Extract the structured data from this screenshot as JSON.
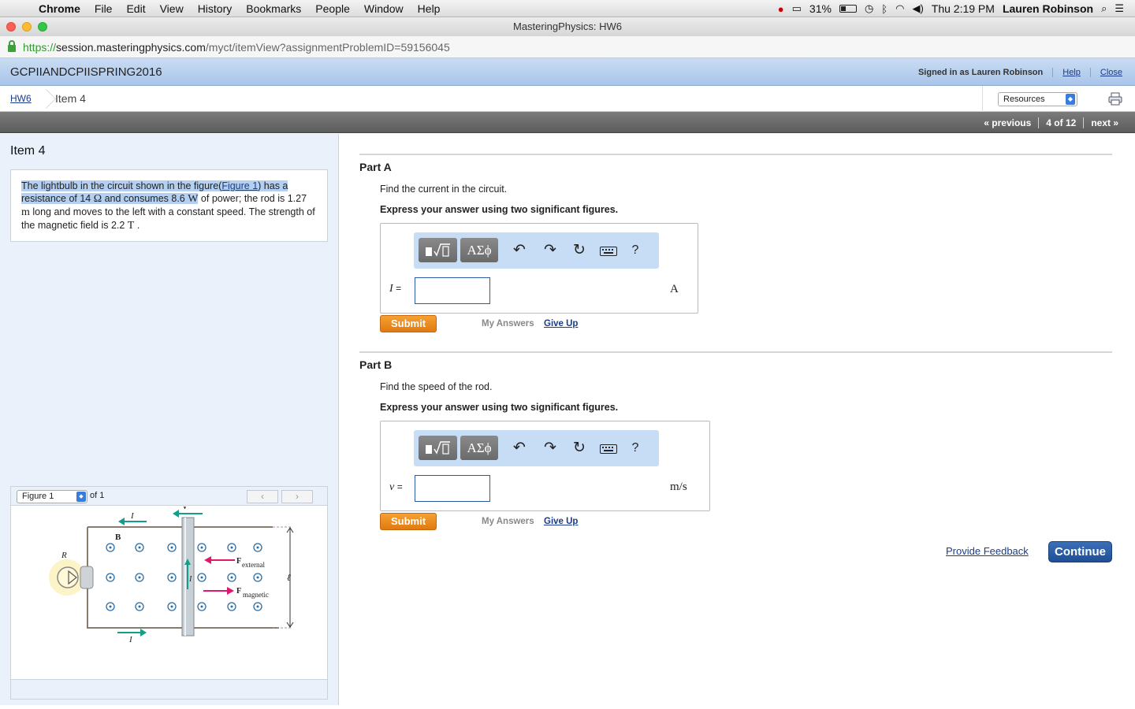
{
  "menubar": {
    "app": "Chrome",
    "items": [
      "File",
      "Edit",
      "View",
      "History",
      "Bookmarks",
      "People",
      "Window",
      "Help"
    ],
    "battery": "31%",
    "clock": "Thu 2:19 PM",
    "user": "Lauren Robinson"
  },
  "window": {
    "title": "MasteringPhysics: HW6"
  },
  "address": {
    "scheme": "https://",
    "host": "session.masteringphysics.com",
    "path": "/myct/itemView?assignmentProblemID=59156045"
  },
  "header": {
    "course": "GCPIIANDCPIISPRING2016",
    "signed_in": "Signed in as Lauren Robinson",
    "help": "Help",
    "close": "Close"
  },
  "breadcrumb": {
    "hw": "HW6",
    "item": "Item 4"
  },
  "resources": {
    "selected": "Resources"
  },
  "pager": {
    "previous": "« previous",
    "position": "4 of 12",
    "next": "next »"
  },
  "left": {
    "title": "Item 4",
    "problem": {
      "p1": "The lightbulb in the circuit shown in the figure(",
      "link": "Figure 1",
      "p2": ") has a resistance of 14 ",
      "u1": "Ω",
      "p3": " and consumes 8.6 ",
      "u2": "W",
      "p4": " of power; the rod is 1.27 ",
      "u3": "m",
      "p5": " long and moves to the left with a constant speed. The strength of the magnetic field is 2.2 ",
      "u4": "T",
      "p6": " ."
    },
    "figure": {
      "select": "Figure 1",
      "of": "of 1",
      "prev": "‹",
      "next": "›",
      "labels": {
        "v": "v",
        "I_top": "I",
        "B": "B",
        "R": "R",
        "I_rod": "I",
        "F": "F",
        "external": "external",
        "magnetic": "magnetic",
        "ell": "ℓ",
        "I_bottom": "I"
      }
    }
  },
  "partA": {
    "title": "Part A",
    "prompt": "Find the current in the circuit.",
    "instruction": "Express your answer using two significant figures.",
    "variable": "I",
    "equals": "=",
    "unit": "A",
    "value": "",
    "submit": "Submit",
    "my_answers": "My Answers",
    "give_up": "Give Up"
  },
  "partB": {
    "title": "Part B",
    "prompt": "Find the speed of the rod.",
    "instruction": "Express your answer using two significant figures.",
    "variable": "v",
    "equals": "=",
    "unit": "m/s",
    "value": "",
    "submit": "Submit",
    "my_answers": "My Answers",
    "give_up": "Give Up"
  },
  "toolbar": {
    "greek": "ΑΣϕ",
    "help": "?"
  },
  "footer": {
    "feedback": "Provide Feedback",
    "continue": "Continue"
  }
}
